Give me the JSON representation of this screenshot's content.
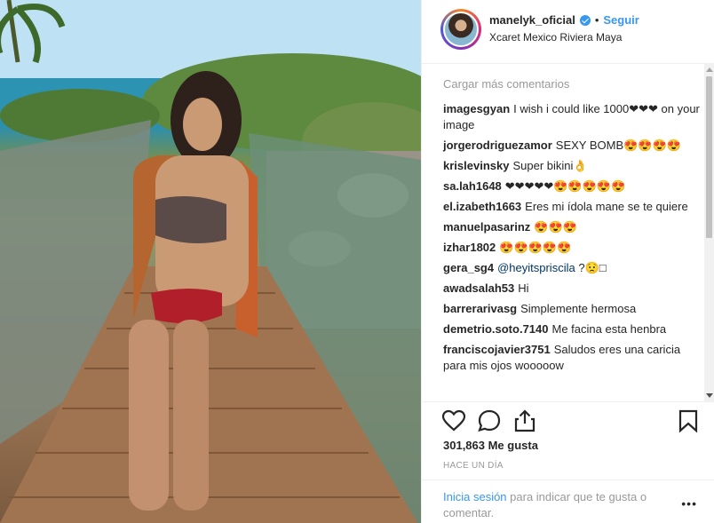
{
  "post": {
    "username": "manelyk_oficial",
    "follow_label": "Seguir",
    "location": "Xcaret Mexico Riviera Maya",
    "load_more_label": "Cargar más comentarios",
    "comments": [
      {
        "user": "imagesgyan",
        "text": "I wish i could like 1000❤❤❤ on your image"
      },
      {
        "user": "jorgerodriguezamor",
        "text": "SEXY BOMB😍😍😍😍"
      },
      {
        "user": "krislevinsky",
        "text": "Super bikini👌"
      },
      {
        "user": "sa.lah1648",
        "text": "❤❤❤❤❤😍😍😍😍😍"
      },
      {
        "user": "el.izabeth1663",
        "text": "Eres mi ídola mane se te quiere"
      },
      {
        "user": "manuelpasarinz",
        "text": "😍😍😍"
      },
      {
        "user": "izhar1802",
        "text": "😍😍😍😍😍"
      },
      {
        "user": "gera_sg4",
        "mention": "@heyitspriscila",
        "text": "?😟□"
      },
      {
        "user": "awadsalah53",
        "text": "Hi"
      },
      {
        "user": "barrerarivasg",
        "text": "Simplemente hermosa"
      },
      {
        "user": "demetrio.soto.7140",
        "text": "Me facina esta henbra"
      },
      {
        "user": "franciscojavier3751",
        "text": "Saludos eres una caricia para mis ojos wooooow"
      }
    ],
    "likes_label": "301,863 Me gusta",
    "time_label": "HACE UN DÍA",
    "login_label": "Inicia sesión",
    "login_rest": " para indicar que te gusta o comentar.",
    "more_label": "•••",
    "icons": [
      "heart-icon",
      "comment-icon",
      "share-icon",
      "bookmark-icon",
      "verified-badge-icon"
    ],
    "colors": {
      "accent": "#3897f0",
      "text": "#262626",
      "muted": "#999999"
    }
  }
}
